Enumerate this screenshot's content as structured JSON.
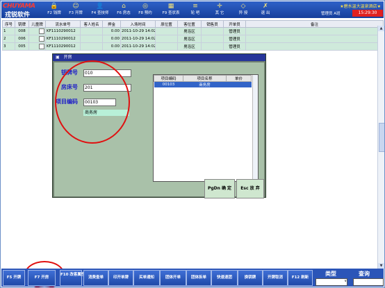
{
  "toolbar": {
    "logo_top": "CHUYAMA",
    "logo_bottom": "戎锐软件",
    "buttons": [
      {
        "key": "F2",
        "label": "F2 钱牌",
        "icon": "🔒"
      },
      {
        "key": "F3",
        "label": "F3 开牌",
        "icon": "☺"
      },
      {
        "key": "F4",
        "label": "F4 查技师",
        "icon": "👤"
      },
      {
        "key": "F6",
        "label": "F6 房态",
        "icon": "⌂"
      },
      {
        "key": "F8",
        "label": "F8 预约",
        "icon": "◎"
      },
      {
        "key": "F9",
        "label": "F9 查状表",
        "icon": "▦"
      },
      {
        "key": "sync",
        "label": "轮 吧",
        "icon": "≡"
      },
      {
        "key": "other",
        "label": "其 它",
        "icon": "✛"
      },
      {
        "key": "swap",
        "label": "异 授",
        "icon": "◇"
      },
      {
        "key": "exit",
        "label": "退 出",
        "icon": "✗"
      }
    ],
    "hotel_name": "★碧水温大温泉酒店★",
    "user_label": "管理员",
    "user_id": "A班",
    "clock": "15:29:30"
  },
  "grid": {
    "columns": [
      "序号",
      "钥牌",
      "儿童牌",
      "流水单号",
      "客人姓名",
      "押金",
      "入场时间",
      "原位置",
      "客位置",
      "销售员",
      "开单员",
      "备注"
    ],
    "rows": [
      [
        "1",
        "008",
        "",
        "KF1110290012",
        "",
        "0.00",
        "2011-10-29 14:02",
        "",
        "男浴区",
        "",
        "管理员",
        ""
      ],
      [
        "2",
        "006",
        "",
        "KF1110290012",
        "",
        "0.00",
        "2011-10-29 14:02",
        "",
        "男浴区",
        "",
        "管理员",
        ""
      ],
      [
        "3",
        "005",
        "",
        "KF1110290012",
        "",
        "0.00",
        "2011-10-29 14:02",
        "",
        "男浴区",
        "",
        "管理员",
        ""
      ]
    ]
  },
  "dialog": {
    "title": "开房",
    "key_label": "钥牌号",
    "key_value": "010",
    "room_label": "房床号",
    "room_value": "201",
    "item_label": "项目编码",
    "item_value": "00103",
    "item_name": "商务房",
    "list_columns": [
      "项目编码",
      "项目名称",
      "单价"
    ],
    "list_rows": [
      [
        "00103",
        "商务房",
        ""
      ]
    ],
    "ok_label": "PgDn 确 定",
    "cancel_label": "Esc 放 弃"
  },
  "bottom": {
    "buttons": [
      "F5 开牌",
      "F7 开房",
      "F10 改客属性",
      "消费查单",
      "印开单牌",
      "买单通知",
      "团体开单",
      "团体拆单",
      "快速退团",
      "换钥牌",
      "开牌取消",
      "F12 刷新"
    ],
    "type_label": "类型",
    "query_label": "查询",
    "type_select": "∨"
  },
  "colors": {
    "accent": "#1f49a8",
    "annotation": "#e01010",
    "title_bar": "#26359a"
  }
}
